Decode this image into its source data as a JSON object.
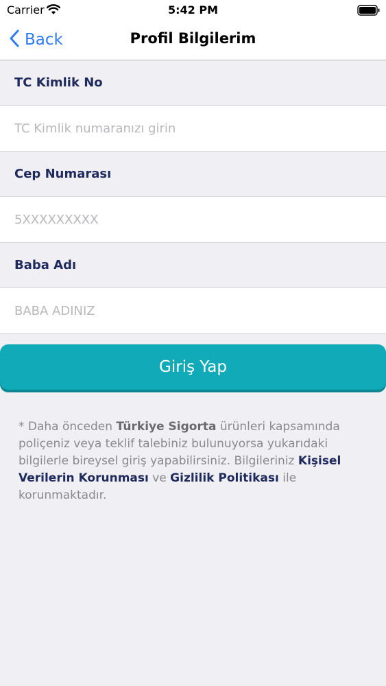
{
  "status_bar": {
    "carrier": "Carrier",
    "time": "5:42 PM"
  },
  "nav": {
    "back_label": "Back",
    "title": "Profil Bilgilerim"
  },
  "form": {
    "fields": [
      {
        "label": "TC Kimlik No",
        "placeholder": "TC Kimlik numaranızı girin",
        "value": ""
      },
      {
        "label": "Cep Numarası",
        "placeholder": "5XXXXXXXXX",
        "value": ""
      },
      {
        "label": "Baba Adı",
        "placeholder": "BABA ADINIZ",
        "value": ""
      }
    ],
    "submit_label": "Giriş Yap"
  },
  "info": {
    "part1": "* Daha önceden ",
    "brand": "Türkiye Sigorta",
    "part2": " ürünleri kapsamında poliçeniz veya teklif talebiniz bulunuyorsa yukarıdaki bilgilerle bireysel giriş yapabilirsiniz. Bilgileriniz ",
    "link_kvk": "Kişisel Verilerin Korunması",
    "part3": " ve ",
    "link_privacy": "Gizlilik Politikası",
    "part4": " ile korunmaktadır."
  },
  "colors": {
    "accent": "#11aab8",
    "link_blue": "#2f7cf6",
    "label_navy": "#1f2a5c"
  },
  "icons": [
    "wifi-icon",
    "battery-icon",
    "chevron-left-icon"
  ]
}
